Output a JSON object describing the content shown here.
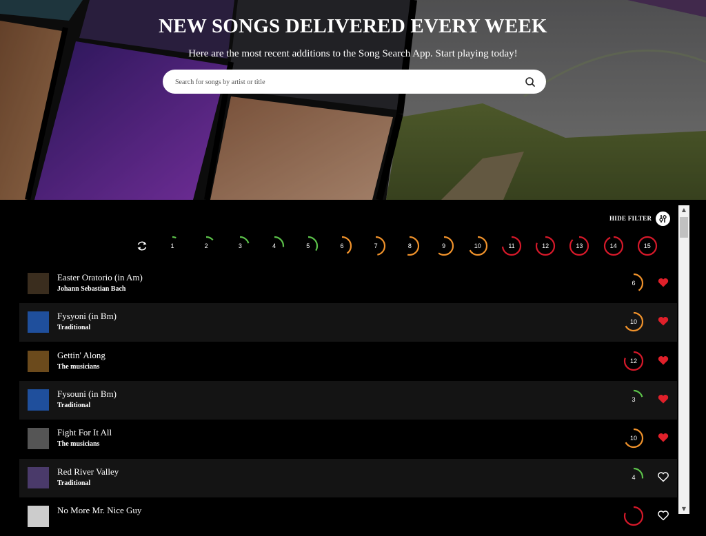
{
  "hero": {
    "title": "NEW SONGS DELIVERED EVERY WEEK",
    "subtitle": "Here are the most recent additions to the Song Search App. Start playing today!"
  },
  "search": {
    "placeholder": "Search for songs by artist or title",
    "icon": "search-icon"
  },
  "filter": {
    "hide_label": "HIDE FILTER",
    "toggle_icon": "sliders-icon",
    "reset_icon": "refresh-icon",
    "level_max": 15,
    "levels": [
      {
        "label": "1",
        "level": 1,
        "color": "#5cc24a"
      },
      {
        "label": "2",
        "level": 2,
        "color": "#5cc24a"
      },
      {
        "label": "3",
        "level": 3,
        "color": "#5cc24a"
      },
      {
        "label": "4",
        "level": 4,
        "color": "#5cc24a"
      },
      {
        "label": "5",
        "level": 5,
        "color": "#5cc24a"
      },
      {
        "label": "6",
        "level": 6,
        "color": "#f0922b"
      },
      {
        "label": "7",
        "level": 7,
        "color": "#f0922b"
      },
      {
        "label": "8",
        "level": 8,
        "color": "#f0922b"
      },
      {
        "label": "9",
        "level": 9,
        "color": "#f0922b"
      },
      {
        "label": "10",
        "level": 10,
        "color": "#f0922b"
      },
      {
        "label": "11",
        "level": 11,
        "color": "#d7192a"
      },
      {
        "label": "12",
        "level": 12,
        "color": "#d7192a"
      },
      {
        "label": "13",
        "level": 13,
        "color": "#d7192a"
      },
      {
        "label": "14",
        "level": 14,
        "color": "#d7192a"
      },
      {
        "label": "15",
        "level": 15,
        "color": "#d7192a"
      }
    ]
  },
  "songs": [
    {
      "title": "Easter Oratorio (in Am)",
      "artist": "Johann Sebastian Bach",
      "level": "6",
      "color": "#f0922b",
      "favorite": true,
      "thumb_color": "#3a2d1e"
    },
    {
      "title": "Fysyoni (in Bm)",
      "artist": "Traditional",
      "level": "10",
      "color": "#f0922b",
      "favorite": true,
      "thumb_color": "#1f4f9c"
    },
    {
      "title": "Gettin' Along",
      "artist": "The musicians",
      "level": "12",
      "color": "#d7192a",
      "favorite": true,
      "thumb_color": "#6b4a1c"
    },
    {
      "title": "Fysouni (in Bm)",
      "artist": "Traditional",
      "level": "3",
      "color": "#5cc24a",
      "favorite": true,
      "thumb_color": "#1f4f9c"
    },
    {
      "title": "Fight For It All",
      "artist": "The musicians",
      "level": "10",
      "color": "#f0922b",
      "favorite": true,
      "thumb_color": "#555555"
    },
    {
      "title": "Red River Valley",
      "artist": "Traditional",
      "level": "4",
      "color": "#5cc24a",
      "favorite": false,
      "thumb_color": "#4a3a6a"
    },
    {
      "title": "No More Mr. Nice Guy",
      "artist": "",
      "level": "",
      "color": "#d7192a",
      "favorite": false,
      "thumb_color": "#cccccc"
    }
  ],
  "colors": {
    "favorite": "#e0202a",
    "unfavorite": "#ffffff"
  }
}
